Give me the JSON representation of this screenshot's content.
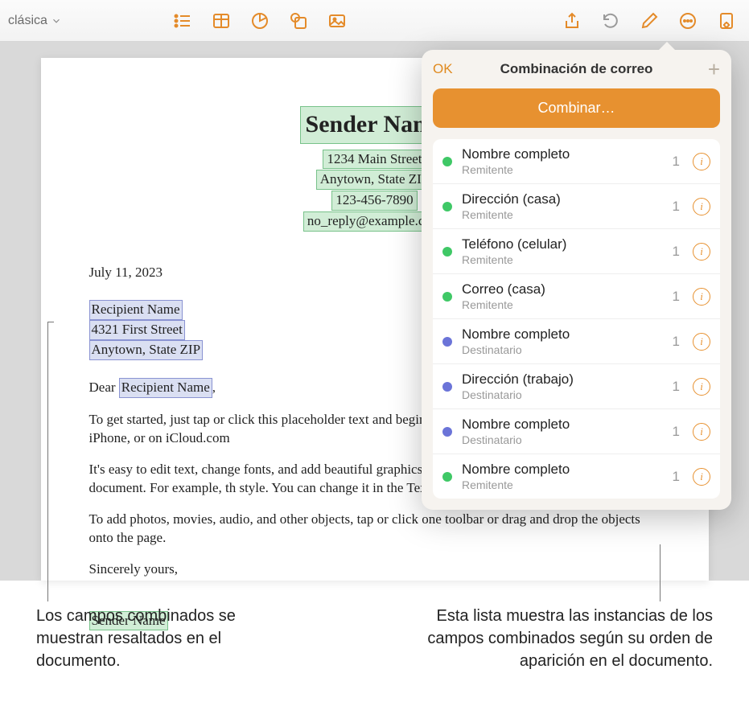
{
  "toolbar": {
    "style_name": "clásica"
  },
  "document": {
    "sender": {
      "name": "Sender Name",
      "street": "1234 Main Street",
      "city": "Anytown, State ZIP",
      "phone": "123-456-7890",
      "email": "no_reply@example.com"
    },
    "date": "July 11, 2023",
    "recipient": {
      "name": "Recipient Name",
      "street": "4321 First Street",
      "city": "Anytown, State ZIP"
    },
    "greeting_prefix": "Dear ",
    "greeting_name": "Recipient Name",
    "greeting_suffix": ",",
    "body": [
      "To get started, just tap or click this placeholder text and begin ty edit this document on your Mac, iPad, iPhone, or on iCloud.com",
      "It's easy to edit text, change fonts, and add beautiful graphics. Us get a consistent look throughout your document. For example, th style. You can change it in the Text tab of the Format controls.",
      "To add photos, movies, audio, and other objects, tap or click one toolbar or drag and drop the objects onto the page."
    ],
    "closing": "Sincerely yours,",
    "signature": "Sender Name"
  },
  "popover": {
    "ok_label": "OK",
    "title": "Combinación de correo",
    "combine_label": "Combinar…",
    "fields": [
      {
        "name": "Nombre completo",
        "role": "Remitente",
        "count": "1",
        "color": "green"
      },
      {
        "name": "Dirección (casa)",
        "role": "Remitente",
        "count": "1",
        "color": "green"
      },
      {
        "name": "Teléfono (celular)",
        "role": "Remitente",
        "count": "1",
        "color": "green"
      },
      {
        "name": "Correo (casa)",
        "role": "Remitente",
        "count": "1",
        "color": "green"
      },
      {
        "name": "Nombre completo",
        "role": "Destinatario",
        "count": "1",
        "color": "blue"
      },
      {
        "name": "Dirección (trabajo)",
        "role": "Destinatario",
        "count": "1",
        "color": "blue"
      },
      {
        "name": "Nombre completo",
        "role": "Destinatario",
        "count": "1",
        "color": "blue"
      },
      {
        "name": "Nombre completo",
        "role": "Remitente",
        "count": "1",
        "color": "green"
      }
    ]
  },
  "callouts": {
    "left": "Los campos combinados se muestran resaltados en el documento.",
    "right": "Esta lista muestra las instancias de los campos combinados según su orden de aparición en el documento."
  }
}
